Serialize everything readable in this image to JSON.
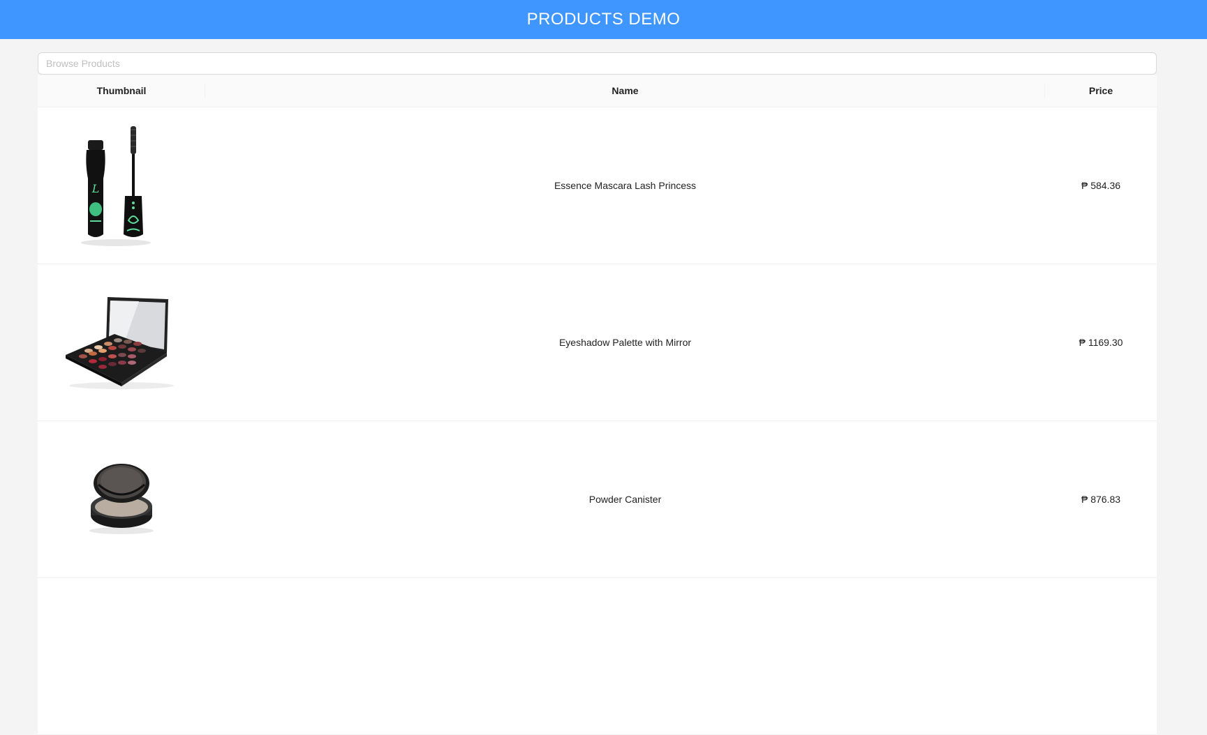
{
  "header": {
    "title": "PRODUCTS DEMO"
  },
  "search": {
    "placeholder": "Browse Products",
    "value": ""
  },
  "table": {
    "columns": [
      "Thumbnail",
      "Name",
      "Price"
    ],
    "rows": [
      {
        "thumbnail": "mascara-image",
        "name": "Essence Mascara Lash Princess",
        "price": "₱ 584.36"
      },
      {
        "thumbnail": "eyeshadow-palette-image",
        "name": "Eyeshadow Palette with Mirror",
        "price": "₱ 1169.30"
      },
      {
        "thumbnail": "powder-canister-image",
        "name": "Powder Canister",
        "price": "₱ 876.83"
      }
    ]
  },
  "colors": {
    "header_bg": "#4096ff",
    "page_bg": "#f4f4f4",
    "table_header_bg": "#fafafa"
  }
}
